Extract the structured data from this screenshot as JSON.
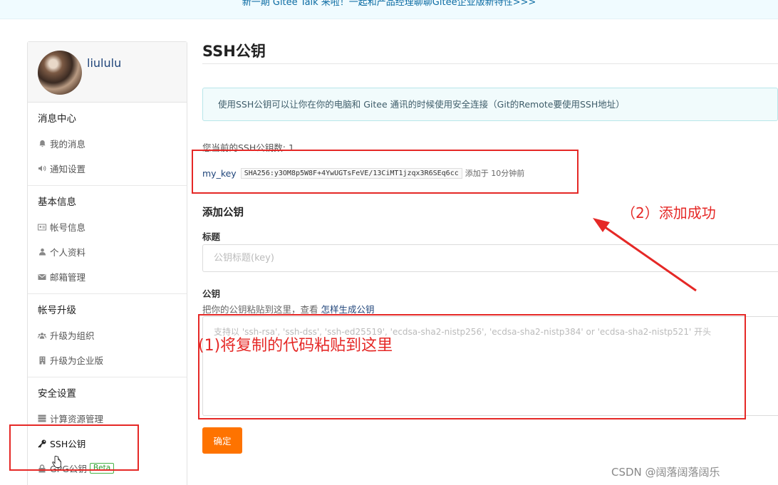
{
  "banner": {
    "text": "新一期 Gitee Talk 来啦！一起和产品经理聊聊Gitee企业版新特性>>>"
  },
  "sidebar": {
    "username": "liululu",
    "sections": [
      {
        "title": "消息中心",
        "items": [
          {
            "label": "我的消息",
            "icon": "bell-icon"
          },
          {
            "label": "通知设置",
            "icon": "speaker-icon"
          }
        ]
      },
      {
        "title": "基本信息",
        "items": [
          {
            "label": "帐号信息",
            "icon": "id-card-icon"
          },
          {
            "label": "个人资料",
            "icon": "user-icon"
          },
          {
            "label": "邮箱管理",
            "icon": "envelope-icon"
          }
        ]
      },
      {
        "title": "帐号升级",
        "items": [
          {
            "label": "升级为组织",
            "icon": "users-icon"
          },
          {
            "label": "升级为企业版",
            "icon": "building-icon"
          }
        ]
      },
      {
        "title": "安全设置",
        "items": [
          {
            "label": "计算资源管理",
            "icon": "server-icon"
          },
          {
            "label": "SSH公钥",
            "icon": "key-icon",
            "active": true
          },
          {
            "label": "GPG公钥",
            "icon": "lock-icon",
            "badge": "Beta"
          }
        ]
      }
    ]
  },
  "main": {
    "title": "SSH公钥",
    "info": "使用SSH公钥可以让你在你的电脑和 Gitee 通讯的时候使用安全连接（Git的Remote要使用SSH地址）",
    "count_label": "您当前的SSH公钥数: 1",
    "key": {
      "name": "my_key",
      "fingerprint": "SHA256:y3OM8p5W8F+4YwUGTsFeVE/13CiMT1jzqx3R6SEq6cc",
      "added": "添加于 10分钟前"
    },
    "add_title": "添加公钥",
    "title_label": "标题",
    "title_placeholder": "公钥标题(key)",
    "key_label": "公钥",
    "hint_text": "把你的公钥粘贴到这里，查看 ",
    "hint_link": "怎样生成公钥",
    "key_placeholder": "支持以 'ssh-rsa', 'ssh-dss', 'ssh-ed25519', 'ecdsa-sha2-nistp256', 'ecdsa-sha2-nistp384' or 'ecdsa-sha2-nistp521' 开头",
    "submit_label": "确定"
  },
  "annotations": {
    "step1": "(1)将复制的代码粘贴到这里",
    "step2": "（2）添加成功",
    "color": "#e52826"
  },
  "watermark": "CSDN @阔落阔落阔乐",
  "colors": {
    "accent": "#fe7300",
    "link": "#20457a",
    "annotation": "#e52826"
  }
}
